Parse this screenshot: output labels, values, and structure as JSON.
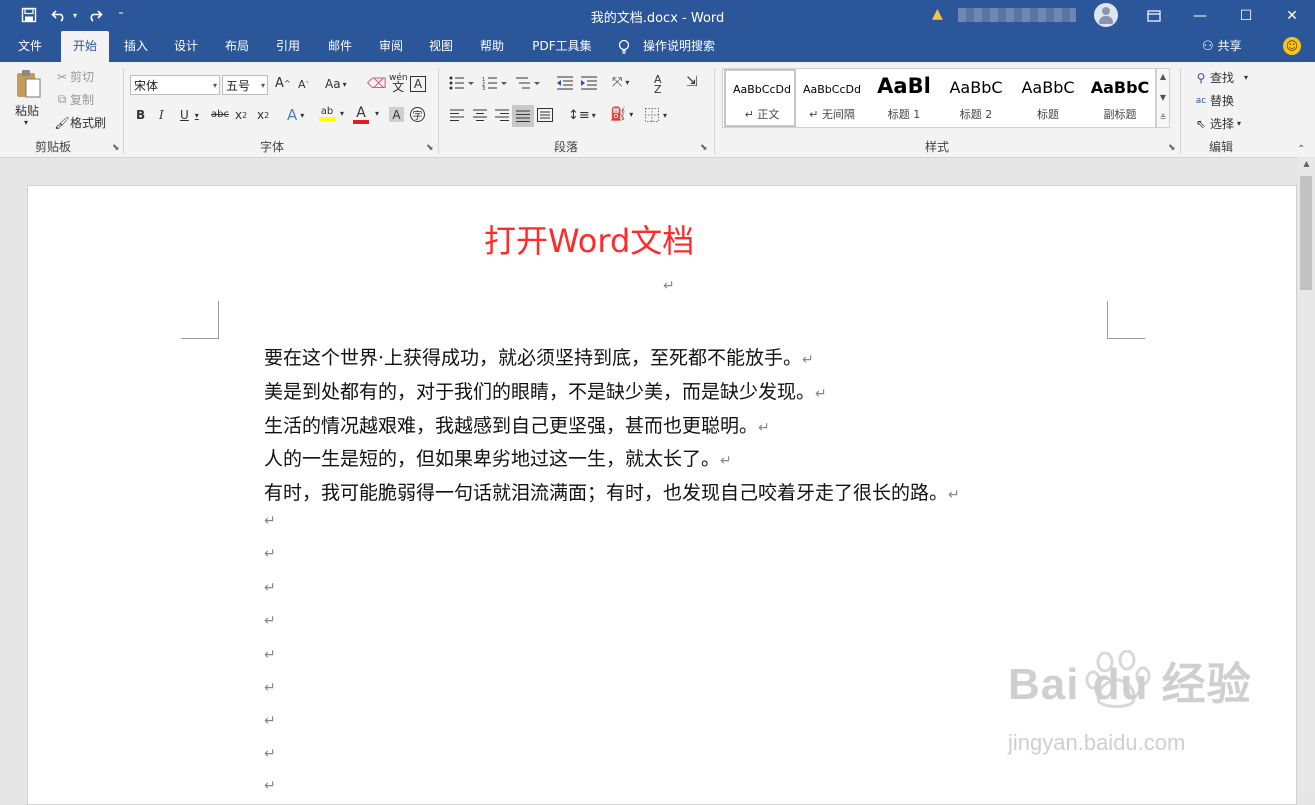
{
  "titlebar": {
    "doc_title": "我的文档.docx  -  Word",
    "minimize": "—",
    "maximize": "☐",
    "close": "✕",
    "ribbon_display_icon": "ribbon-display-icon"
  },
  "quick_access": {
    "save": "save-icon",
    "undo": "undo-icon",
    "redo": "redo-icon",
    "customize": "customize-icon"
  },
  "tabs": [
    "文件",
    "开始",
    "插入",
    "设计",
    "布局",
    "引用",
    "邮件",
    "审阅",
    "视图",
    "帮助",
    "PDF工具集"
  ],
  "active_tab": "开始",
  "tell_me": "操作说明搜索",
  "share": "共享",
  "clipboard": {
    "paste": "粘贴",
    "cut": "剪切",
    "copy": "复制",
    "format_painter": "格式刷",
    "group": "剪贴板"
  },
  "font": {
    "name": "宋体",
    "size": "五号",
    "group": "字体",
    "grow": "A",
    "shrink": "A",
    "case": "Aa"
  },
  "paragraph": {
    "group": "段落"
  },
  "styles": {
    "group": "样式",
    "items": [
      {
        "sample": "AaBbCcDd",
        "name": "↵ 正文"
      },
      {
        "sample": "AaBbCcDd",
        "name": "↵ 无间隔"
      },
      {
        "sample": "AaBl",
        "name": "标题 1"
      },
      {
        "sample": "AaBbC",
        "name": "标题 2"
      },
      {
        "sample": "AaBbC",
        "name": "标题"
      },
      {
        "sample": "AaBbC",
        "name": "副标题"
      }
    ]
  },
  "editing": {
    "find": "查找",
    "replace": "替换",
    "select": "选择",
    "group": "编辑"
  },
  "document": {
    "heading": "打开Word文档",
    "mark": "↵",
    "paragraphs": [
      "要在这个世界·上获得成功，就必须坚持到底，至死都不能放手。",
      "美是到处都有的，对于我们的眼睛，不是缺少美，而是缺少发现。",
      "生活的情况越艰难，我越感到自己更坚强，甚而也更聪明。",
      "人的一生是短的，但如果卑劣地过这一生，就太长了。",
      "有时，我可能脆弱得一句话就泪流满面；有时，也发现自己咬着牙走了很长的路。"
    ]
  },
  "watermark": {
    "logo": "Bai du 经验",
    "url": "jingyan.baidu.com"
  },
  "colors": {
    "accent": "#2b579a",
    "heading": "#ff2a2a"
  }
}
